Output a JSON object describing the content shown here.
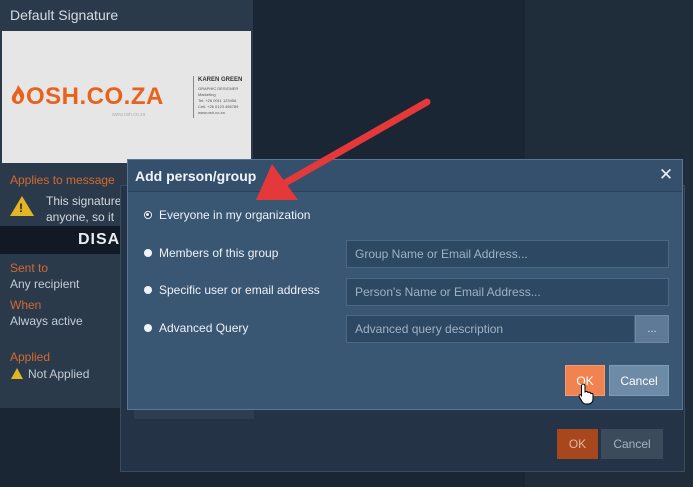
{
  "signature_panel": {
    "title": "Default Signature",
    "preview": {
      "logo_text": "OSH.CO.ZA",
      "logo_subtext": "www.osh.co.za",
      "contact_name": "KAREN GREEN",
      "contact_lines": [
        "GRAPHIC DESIGNER",
        "Marketing",
        "Tel: +26 0011 123456",
        "Cell: +26 0123 456789",
        "www.osh.co.za"
      ]
    },
    "applies_label": "Applies to message",
    "notice_lines": [
      "This signature",
      "anyone, so it"
    ],
    "disabled_banner": "DISA",
    "sent_to_label": "Sent to",
    "sent_to_value": "Any recipient",
    "when_label": "When",
    "when_value": "Always active",
    "applied_label": "Applied",
    "applied_value": "Not Applied"
  },
  "back_dialog": {
    "ok_label": "OK",
    "cancel_label": "Cancel"
  },
  "dialog": {
    "title": "Add person/group",
    "close_glyph": "✕",
    "options": [
      {
        "label": "Everyone in my organization",
        "selected": true
      },
      {
        "label": "Members of this group",
        "selected": false,
        "placeholder": "Group Name or Email Address..."
      },
      {
        "label": "Specific user or email address",
        "selected": false,
        "placeholder": "Person's Name or Email Address..."
      },
      {
        "label": "Advanced Query",
        "selected": false,
        "placeholder": "Advanced query description"
      }
    ],
    "browse_label": "...",
    "ok_label": "OK",
    "cancel_label": "Cancel"
  },
  "colors": {
    "accent_orange": "#f0834f",
    "dialog_bg": "#395673",
    "annotation_arrow": "#e5383b",
    "warning_yellow": "#e3b423"
  },
  "icons": {
    "warning": "warning-triangle-icon",
    "close": "close-icon",
    "cursor": "hand-pointer-icon"
  }
}
